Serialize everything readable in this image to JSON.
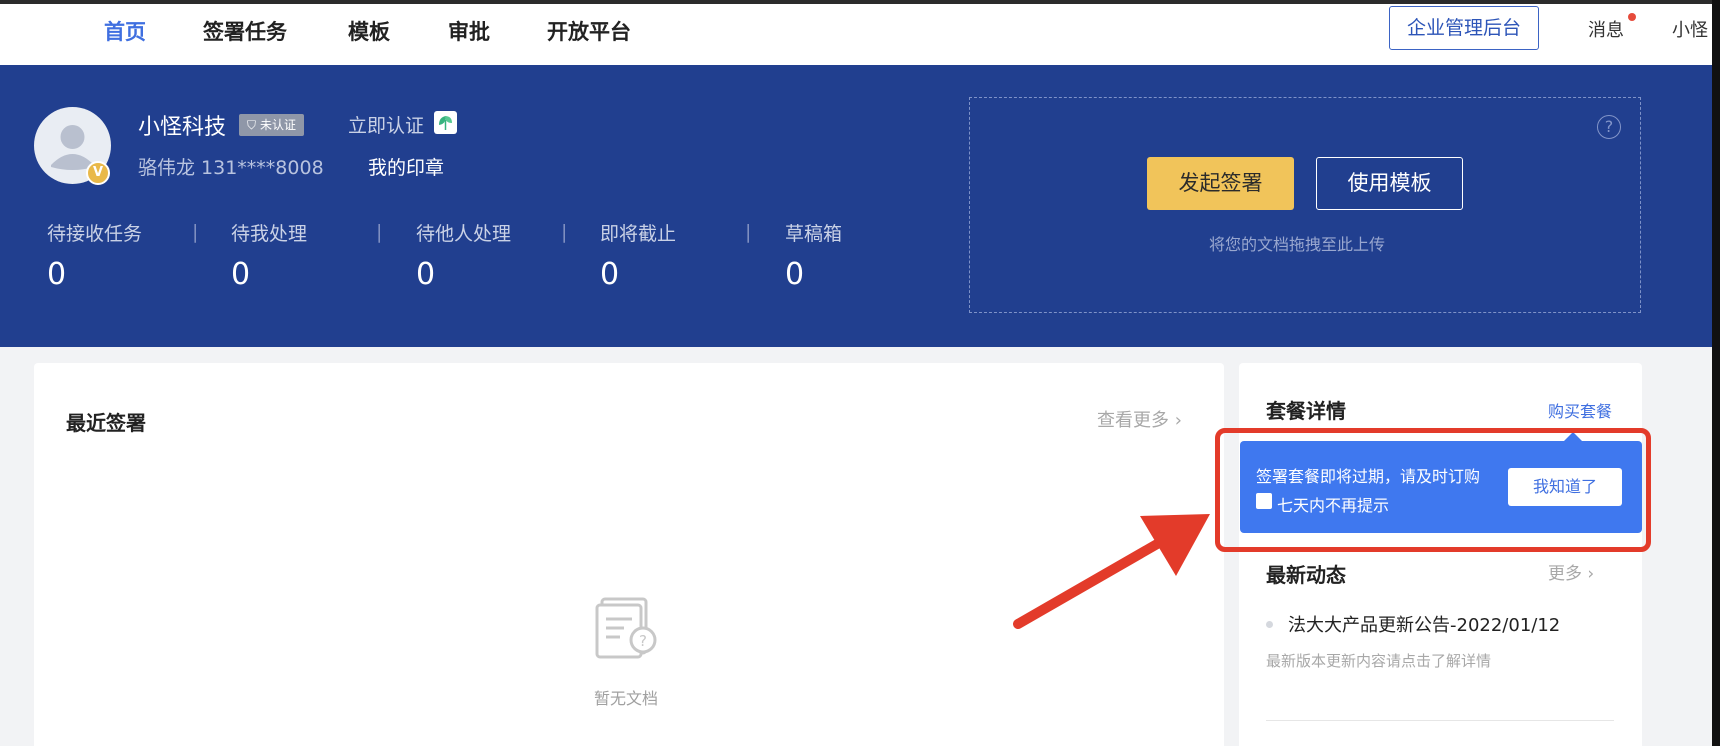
{
  "nav": {
    "items": [
      {
        "label": "首页",
        "active": true
      },
      {
        "label": "签署任务",
        "active": false
      },
      {
        "label": "模板",
        "active": false
      },
      {
        "label": "审批",
        "active": false
      },
      {
        "label": "开放平台",
        "active": false
      }
    ],
    "admin_label": "企业管理后台",
    "messages_label": "消息",
    "user_short": "小怪"
  },
  "profile": {
    "company": "小怪科技",
    "status_badge": "未认证",
    "verify_link": "立即认证",
    "person": "骆伟龙 131****8008",
    "my_seal": "我的印章",
    "avatar_badge": "V"
  },
  "stats": [
    {
      "label": "待接收任务",
      "value": "0"
    },
    {
      "label": "待我处理",
      "value": "0"
    },
    {
      "label": "待他人处理",
      "value": "0"
    },
    {
      "label": "即将截止",
      "value": "0"
    },
    {
      "label": "草稿箱",
      "value": "0"
    }
  ],
  "upload": {
    "help_symbol": "?",
    "start_label": "发起签署",
    "template_label": "使用模板",
    "hint": "将您的文档拖拽至此上传"
  },
  "recent": {
    "title": "最近签署",
    "view_more": "查看更多",
    "empty_text": "暂无文档"
  },
  "plan": {
    "title": "套餐详情",
    "buy_label": "购买套餐"
  },
  "tooltip": {
    "text": "签署套餐即将过期，请及时订购",
    "checkbox_label": "七天内不再提示",
    "checkbox_checked": false,
    "button_label": "我知道了"
  },
  "news": {
    "title": "最新动态",
    "more_label": "更多",
    "items": [
      {
        "title": "法大大产品更新公告-2022/01/12",
        "desc": "最新版本更新内容请点击了解详情"
      }
    ]
  },
  "colors": {
    "banner": "#213f8f",
    "accent": "#3f6fe0",
    "start_button": "#f1c45a",
    "tooltip": "#3f78ef",
    "annotation": "#e33b2a"
  }
}
